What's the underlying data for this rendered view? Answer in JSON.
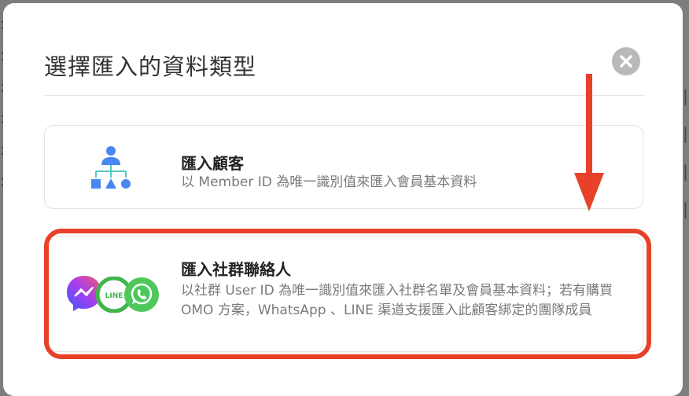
{
  "dialog": {
    "title": "選擇匯入的資料類型",
    "close_icon": "close-icon"
  },
  "options": [
    {
      "title": "匯入顧客",
      "description": "以 Member ID 為唯一識別值來匯入會員基本資料",
      "icon": "hierarchy-icon"
    },
    {
      "title": "匯入社群聯絡人",
      "description": "以社群 User ID 為唯一識別值來匯入社群名單及會員基本資料；若有購買 OMO 方案，WhatsApp 、LINE 渠道支援匯入此顧客綁定的團隊成員",
      "icons": [
        "messenger-icon",
        "line-icon",
        "whatsapp-icon"
      ],
      "line_logo_text": "LINE",
      "highlighted": true
    }
  ],
  "colors": {
    "highlight": "#e8412a",
    "hierarchy_blue": "#4a86f0",
    "hierarchy_teal": "#52c8c2",
    "line_green": "#3fb54a",
    "whatsapp_green": "#4fc85b"
  }
}
